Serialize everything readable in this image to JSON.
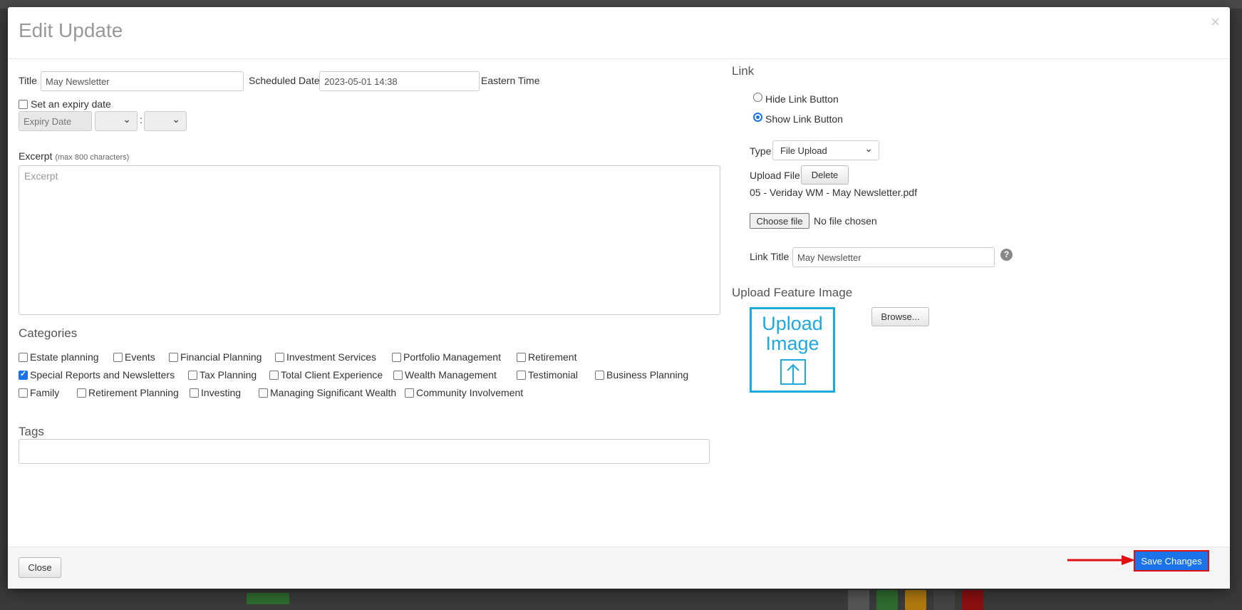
{
  "modal": {
    "title": "Edit Update",
    "close_symbol": "×"
  },
  "form": {
    "title_label": "Title",
    "title_value": "May Newsletter",
    "scheduled_date_label": "Scheduled Date",
    "scheduled_date_value": "2023-05-01 14:38",
    "timezone": "Eastern Time",
    "expiry_label": "Set an expiry date",
    "expiry_checked": false,
    "expiry_date_placeholder": "Expiry Date",
    "time_separator": ":",
    "excerpt_label": "Excerpt",
    "excerpt_hint": "(max 800 characters)",
    "excerpt_placeholder": "Excerpt"
  },
  "categories": {
    "heading": "Categories",
    "items": [
      {
        "label": "Estate planning",
        "checked": false
      },
      {
        "label": "Events",
        "checked": false
      },
      {
        "label": "Financial Planning",
        "checked": false
      },
      {
        "label": "Investment Services",
        "checked": false
      },
      {
        "label": "Portfolio Management",
        "checked": false
      },
      {
        "label": "Retirement",
        "checked": false
      },
      {
        "label": "Special Reports and Newsletters",
        "checked": true
      },
      {
        "label": "Tax Planning",
        "checked": false
      },
      {
        "label": "Total Client Experience",
        "checked": false
      },
      {
        "label": "Wealth Management",
        "checked": false
      },
      {
        "label": "Testimonial",
        "checked": false
      },
      {
        "label": "Business Planning",
        "checked": false
      },
      {
        "label": "Family",
        "checked": false
      },
      {
        "label": "Retirement Planning",
        "checked": false
      },
      {
        "label": "Investing",
        "checked": false
      },
      {
        "label": "Managing Significant Wealth",
        "checked": false
      },
      {
        "label": "Community Involvement",
        "checked": false
      }
    ]
  },
  "tags": {
    "heading": "Tags",
    "value": ""
  },
  "link": {
    "heading": "Link",
    "hide_label": "Hide Link Button",
    "show_label": "Show Link Button",
    "selected": "show",
    "type_label": "Type",
    "type_value": "File Upload",
    "upload_file_label": "Upload File",
    "delete_label": "Delete",
    "file_name": "05 - Veriday WM - May Newsletter.pdf",
    "choose_file_label": "Choose file",
    "no_file_text": "No file chosen",
    "link_title_label": "Link Title",
    "link_title_value": "May Newsletter",
    "help_symbol": "?"
  },
  "feature_image": {
    "heading": "Upload Feature Image",
    "placeholder_line1": "Upload",
    "placeholder_line2": "Image",
    "browse_label": "Browse..."
  },
  "footer": {
    "close_label": "Close",
    "save_label": "Save Changes"
  },
  "colors": {
    "accent": "#1a73e8",
    "upload_blue": "#1eaadf",
    "highlight_red": "#e01010"
  }
}
